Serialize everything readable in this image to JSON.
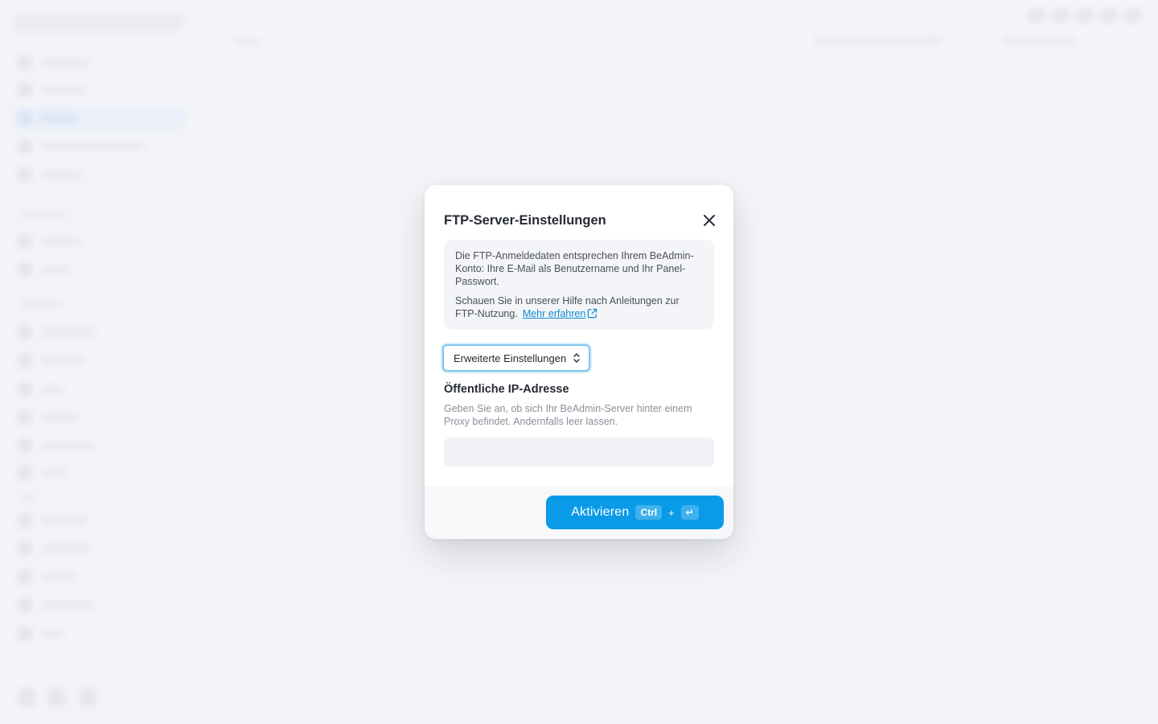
{
  "dialog": {
    "title": "FTP-Server-Einstellungen",
    "info_paragraph_1": "Die FTP-Anmeldedaten entsprechen Ihrem BeAdmin-Konto: Ihre E-Mail als Benutzername und Ihr Panel-Passwort.",
    "info_paragraph_2": "Schauen Sie in unserer Hilfe nach Anleitungen zur FTP-Nutzung.",
    "info_link": "Mehr erfahren",
    "advanced_select": "Erweiterte Einstellungen",
    "ip_field": {
      "label": "Öffentliche IP-Adresse",
      "help": "Geben Sie an, ob sich Ihr BeAdmin-Server hinter einem Proxy befindet. Andernfalls leer lassen.",
      "value": "",
      "placeholder": ""
    },
    "submit": {
      "label": "Aktivieren",
      "shortcut_key_1": "Ctrl",
      "shortcut_plus": "+",
      "shortcut_key_2": "↵"
    }
  },
  "colors": {
    "accent": "#0a9be8",
    "link": "#0b8ed6",
    "focus_ring": "#7cc6f0"
  },
  "icons": {
    "close": "close-icon",
    "external_link": "external-link-icon",
    "select_chevrons": "chevron-up-down-icon"
  }
}
